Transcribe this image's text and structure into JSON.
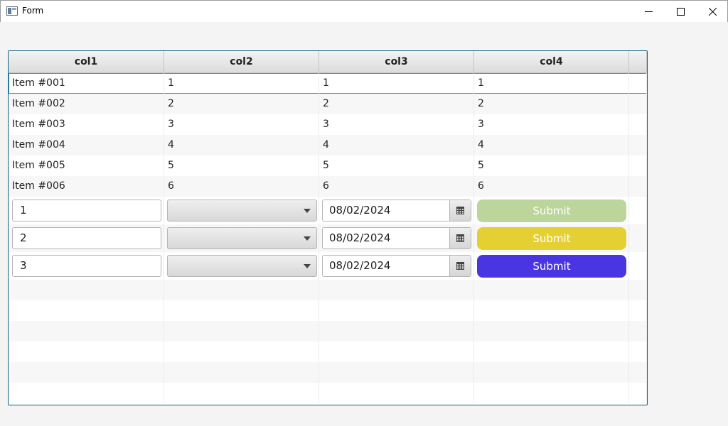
{
  "window": {
    "title": "Form"
  },
  "table": {
    "columns": [
      "col1",
      "col2",
      "col3",
      "col4"
    ],
    "rows": [
      [
        "Item #001",
        "1",
        "1",
        "1"
      ],
      [
        "Item #002",
        "2",
        "2",
        "2"
      ],
      [
        "Item #003",
        "3",
        "3",
        "3"
      ],
      [
        "Item #004",
        "4",
        "4",
        "4"
      ],
      [
        "Item #005",
        "5",
        "5",
        "5"
      ],
      [
        "Item #006",
        "6",
        "6",
        "6"
      ]
    ],
    "form_rows": [
      {
        "text": "1",
        "combo_value": "",
        "date": "08/02/2024",
        "button_label": "Submit",
        "button_color": "#bcd59b"
      },
      {
        "text": "2",
        "combo_value": "",
        "date": "08/02/2024",
        "button_label": "Submit",
        "button_color": "#e5d033"
      },
      {
        "text": "3",
        "combo_value": "",
        "date": "08/02/2024",
        "button_label": "Submit",
        "button_color": "#4a35e2"
      }
    ]
  }
}
